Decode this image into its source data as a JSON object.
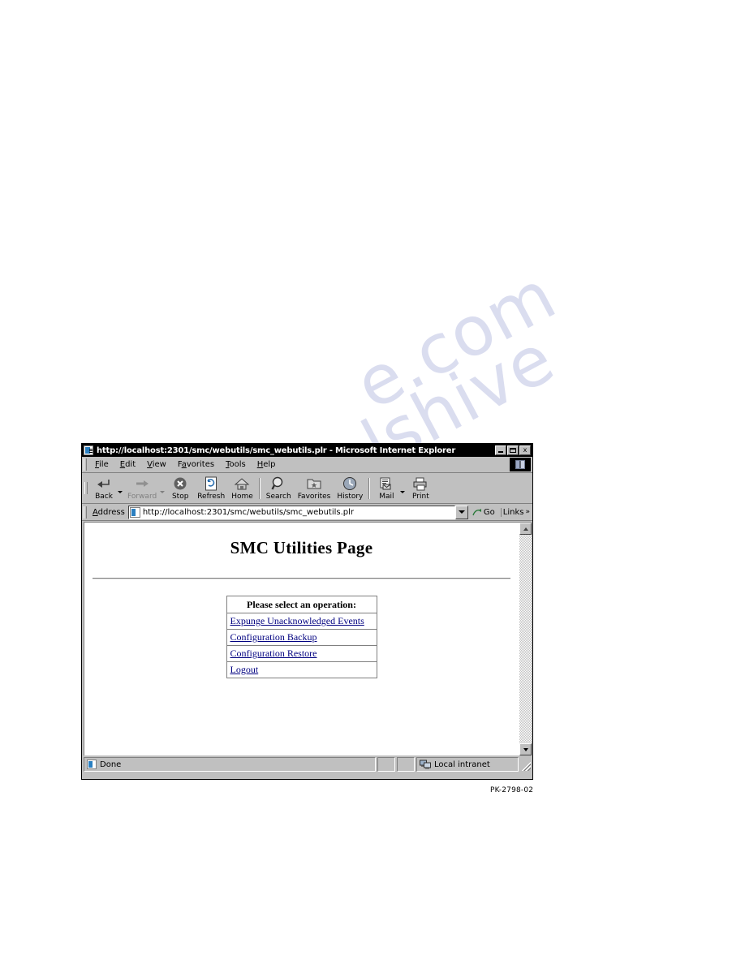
{
  "window": {
    "title": "http://localhost:2301/smc/webutils/smc_webutils.plr - Microsoft Internet Explorer",
    "title_icon": "ie-document-icon",
    "controls": {
      "minimize": "minimize-button",
      "maximize": "maximize-button",
      "close_label": "x"
    }
  },
  "menu": {
    "items": [
      {
        "label": "File",
        "accel": "F"
      },
      {
        "label": "Edit",
        "accel": "E"
      },
      {
        "label": "View",
        "accel": "V"
      },
      {
        "label": "Favorites",
        "accel": "a"
      },
      {
        "label": "Tools",
        "accel": "T"
      },
      {
        "label": "Help",
        "accel": "H"
      }
    ],
    "logo": "ie-animated-logo"
  },
  "toolbar": {
    "buttons": [
      {
        "label": "Back",
        "icon": "back-arrow-icon",
        "disabled": false,
        "has_dropdown": true
      },
      {
        "label": "Forward",
        "icon": "forward-arrow-icon",
        "disabled": true,
        "has_dropdown": true
      },
      {
        "label": "Stop",
        "icon": "stop-icon",
        "disabled": false,
        "has_dropdown": false
      },
      {
        "label": "Refresh",
        "icon": "refresh-icon",
        "disabled": false,
        "has_dropdown": false
      },
      {
        "label": "Home",
        "icon": "home-icon",
        "disabled": false,
        "has_dropdown": false
      },
      {
        "label": "Search",
        "icon": "search-icon",
        "disabled": false,
        "has_dropdown": false
      },
      {
        "label": "Favorites",
        "icon": "favorites-icon",
        "disabled": false,
        "has_dropdown": false
      },
      {
        "label": "History",
        "icon": "history-icon",
        "disabled": false,
        "has_dropdown": false
      },
      {
        "label": "Mail",
        "icon": "mail-icon",
        "disabled": false,
        "has_dropdown": true
      },
      {
        "label": "Print",
        "icon": "print-icon",
        "disabled": false,
        "has_dropdown": false
      }
    ]
  },
  "address": {
    "label": "Address",
    "accel": "A",
    "value": "http://localhost:2301/smc/webutils/smc_webutils.plr",
    "placeholder": "",
    "page_icon": "ie-document-icon",
    "dropdown_icon": "chevron-down-icon",
    "go_label": "Go",
    "go_icon": "go-arrow-icon",
    "links_label": "Links",
    "links_chevron": "»"
  },
  "page": {
    "heading": "SMC Utilities Page",
    "table": {
      "header": "Please select an operation:",
      "links": [
        "Expunge Unacknowledged Events",
        "Configuration Backup",
        "Configuration Restore",
        "Logout"
      ]
    }
  },
  "scrollbar": {
    "up_icon": "scroll-up-arrow-icon",
    "down_icon": "scroll-down-arrow-icon"
  },
  "status": {
    "message": "Done",
    "message_icon": "ie-document-icon",
    "zone": "Local intranet",
    "zone_icon": "network-zone-icon"
  },
  "figure": {
    "caption": "PK-2798-02"
  },
  "watermark": {
    "line1": "e.com",
    "line2": "manualshive"
  },
  "colors": {
    "window_face": "#c0c0c0",
    "title_bar": "#000000",
    "link": "#000080",
    "page_background": "#ffffff",
    "watermark": "#cdd0ea"
  }
}
